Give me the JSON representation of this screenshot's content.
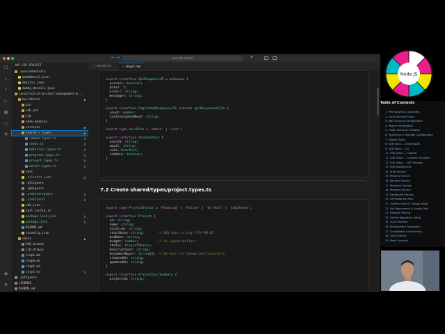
{
  "window": {
    "search_text": "aws-cdk-project",
    "traffic_colors": [
      "#ff5f57",
      "#febc2e",
      "#28c840"
    ]
  },
  "explorer": {
    "header": "AWS-CDK-PROJECT",
    "rows": [
      {
        "label": ".awscredentials",
        "indent": 0,
        "kind": "folder",
        "badge": ""
      },
      {
        "label": "demoDetail.json",
        "indent": 1,
        "kind": "json",
        "badge": ""
      },
      {
        "label": "details.json",
        "indent": 1,
        "kind": "json",
        "badge": ""
      },
      {
        "label": "dummy_details.json",
        "indent": 1,
        "kind": "json",
        "badge": ""
      },
      {
        "label": "construction-project-management-b...",
        "indent": 0,
        "kind": "folder",
        "badge": ""
      },
      {
        "label": "buildtrack",
        "indent": 1,
        "kind": "folder",
        "badge": "●"
      },
      {
        "label": "bin",
        "indent": 2,
        "kind": "folder",
        "badge": ""
      },
      {
        "label": "cdk.out",
        "indent": 2,
        "kind": "folder",
        "badge": ""
      },
      {
        "label": "lib",
        "indent": 2,
        "kind": "folder",
        "badge": ""
      },
      {
        "label": "node_modules",
        "indent": 2,
        "kind": "folder",
        "badge": ""
      },
      {
        "label": "services",
        "indent": 2,
        "kind": "folder",
        "badge": "●"
      },
      {
        "label": "shared / types",
        "indent": 2,
        "kind": "folder",
        "badge": "●"
      },
      {
        "label": "common.types.ts",
        "indent": 3,
        "kind": "ts",
        "badge": "U"
      },
      {
        "label": "index.ts",
        "indent": 3,
        "kind": "ts",
        "badge": "U"
      },
      {
        "label": "materials.types.ts",
        "indent": 3,
        "kind": "ts",
        "badge": "U"
      },
      {
        "label": "progress.types.ts",
        "indent": 3,
        "kind": "ts",
        "badge": "U"
      },
      {
        "label": "project.types.ts",
        "indent": 3,
        "kind": "ts",
        "badge": "U"
      },
      {
        "label": "worker.types.ts",
        "indent": 3,
        "kind": "ts",
        "badge": "U"
      },
      {
        "label": "test",
        "indent": 2,
        "kind": "folder",
        "badge": ""
      },
      {
        "label": ".eslintrc.json",
        "indent": 2,
        "kind": "json",
        "badge": "U"
      },
      {
        "label": ".gitignore",
        "indent": 2,
        "kind": "txt",
        "badge": ""
      },
      {
        "label": ".npmignore",
        "indent": 2,
        "kind": "txt",
        "badge": ""
      },
      {
        "label": ".prettierignore",
        "indent": 2,
        "kind": "txt",
        "badge": "U"
      },
      {
        "label": ".prettierrc",
        "indent": 2,
        "kind": "txt",
        "badge": "U"
      },
      {
        "label": "cdk.json",
        "indent": 2,
        "kind": "json",
        "badge": ""
      },
      {
        "label": "jest.config.js",
        "indent": 2,
        "kind": "js",
        "badge": ""
      },
      {
        "label": "package-lock.json",
        "indent": 2,
        "kind": "json",
        "badge": "U"
      },
      {
        "label": "package.json",
        "indent": 2,
        "kind": "json",
        "badge": "U"
      },
      {
        "label": "README.md",
        "indent": 2,
        "kind": "md",
        "badge": ""
      },
      {
        "label": "tsconfig.json",
        "indent": 2,
        "kind": "json",
        "badge": ""
      },
      {
        "label": "notes",
        "indent": 1,
        "kind": "folder",
        "badge": "●"
      },
      {
        "label": "HLD.drawio",
        "indent": 2,
        "kind": "txt",
        "badge": ""
      },
      {
        "label": "LLD.drawio",
        "indent": 2,
        "kind": "txt",
        "badge": ""
      },
      {
        "label": "step1.md",
        "indent": 2,
        "kind": "md",
        "badge": ""
      },
      {
        "label": "step4.md",
        "indent": 2,
        "kind": "md",
        "badge": ""
      },
      {
        "label": "step5.md",
        "indent": 2,
        "kind": "md",
        "badge": ""
      },
      {
        "label": "step6.md",
        "indent": 2,
        "kind": "md",
        "badge": "U"
      },
      {
        "label": ".gitignore",
        "indent": 0,
        "kind": "txt",
        "badge": ""
      },
      {
        "label": "LICENSE",
        "indent": 0,
        "kind": "txt",
        "badge": ""
      },
      {
        "label": "README.md",
        "indent": 0,
        "kind": "md",
        "badge": ""
      }
    ]
  },
  "tabs": [
    {
      "label": "step6.md",
      "active": false
    },
    {
      "label": "step7.md",
      "active": true
    }
  ],
  "editor": {
    "section_heading": "7.2 Create shared/types/project.types.ts",
    "block1": [
      [
        [
          "kw",
          "export interface "
        ],
        [
          "ty",
          "ApiResponse"
        ],
        [
          "",
          "<T = "
        ],
        [
          "ty",
          "unknown"
        ],
        [
          "",
          "> {"
        ]
      ],
      [
        [
          "",
          "  success: "
        ],
        [
          "ty",
          "boolean"
        ],
        [
          "",
          ";"
        ]
      ],
      [
        [
          "",
          "  data?: T;"
        ]
      ],
      [
        [
          "",
          "  error?: "
        ],
        [
          "ty",
          "string"
        ],
        [
          "",
          ";"
        ]
      ],
      [
        [
          "",
          "  message?: "
        ],
        [
          "ty",
          "string"
        ],
        [
          "",
          ";"
        ]
      ],
      [
        [
          "",
          "}"
        ]
      ],
      [
        [
          "",
          ""
        ]
      ],
      [
        [
          "kw",
          "export interface "
        ],
        [
          "ty",
          "PaginatedResponse"
        ],
        [
          "",
          "<T> "
        ],
        [
          "kw",
          "extends "
        ],
        [
          "ty",
          "ApiResponse"
        ],
        [
          "",
          "<T[]> {"
        ]
      ],
      [
        [
          "",
          "  count: "
        ],
        [
          "ty",
          "number"
        ],
        [
          "",
          ";"
        ]
      ],
      [
        [
          "",
          "  lastEvaluatedKey?: "
        ],
        [
          "ty",
          "string"
        ],
        [
          "",
          ";"
        ]
      ],
      [
        [
          "",
          "}"
        ]
      ],
      [
        [
          "",
          ""
        ]
      ],
      [
        [
          "kw",
          "export type "
        ],
        [
          "ty",
          "UserRole"
        ],
        [
          "",
          " = "
        ],
        [
          "st",
          "'admin'"
        ],
        [
          "",
          " | "
        ],
        [
          "st",
          "'user'"
        ],
        [
          "",
          ";"
        ]
      ],
      [
        [
          "",
          ""
        ]
      ],
      [
        [
          "kw",
          "export interface "
        ],
        [
          "ty",
          "AuthContext"
        ],
        [
          "",
          " {"
        ]
      ],
      [
        [
          "",
          "  userId: "
        ],
        [
          "ty",
          "string"
        ],
        [
          "",
          ";"
        ]
      ],
      [
        [
          "",
          "  email: "
        ],
        [
          "ty",
          "string"
        ],
        [
          "",
          ";"
        ]
      ],
      [
        [
          "",
          "  role: "
        ],
        [
          "ty",
          "UserRole"
        ],
        [
          "",
          ";"
        ]
      ],
      [
        [
          "",
          "  isAdmin: "
        ],
        [
          "ty",
          "boolean"
        ],
        [
          "",
          ";"
        ]
      ],
      [
        [
          "",
          "}"
        ]
      ]
    ],
    "block2": [
      [
        [
          "kw",
          "export type "
        ],
        [
          "ty",
          "ProjectStatus"
        ],
        [
          "",
          " = "
        ],
        [
          "st",
          "'Planning'"
        ],
        [
          "",
          " | "
        ],
        [
          "st",
          "'Active'"
        ],
        [
          "",
          " | "
        ],
        [
          "st",
          "'On Hold'"
        ],
        [
          "",
          " | "
        ],
        [
          "st",
          "'Completed'"
        ],
        [
          "",
          ";"
        ]
      ],
      [
        [
          "",
          ""
        ]
      ],
      [
        [
          "kw",
          "export interface "
        ],
        [
          "ty",
          "Project"
        ],
        [
          "",
          " {"
        ]
      ],
      [
        [
          "",
          "  id: "
        ],
        [
          "ty",
          "string"
        ],
        [
          "",
          ";"
        ]
      ],
      [
        [
          "",
          "  name: "
        ],
        [
          "ty",
          "string"
        ],
        [
          "",
          ";"
        ]
      ],
      [
        [
          "",
          "  location: "
        ],
        [
          "ty",
          "string"
        ],
        [
          "",
          ";"
        ]
      ],
      [
        [
          "",
          "  startDate: "
        ],
        [
          "ty",
          "string"
        ],
        [
          "",
          ";       "
        ],
        [
          "cm",
          "// ISO date string YYYY-MM-DD"
        ]
      ],
      [
        [
          "",
          "  endDate: "
        ],
        [
          "ty",
          "string"
        ],
        [
          "",
          ";"
        ]
      ],
      [
        [
          "",
          "  budget: "
        ],
        [
          "ty",
          "number"
        ],
        [
          "",
          ";          "
        ],
        [
          "cm",
          "// in rupees/dollars"
        ]
      ],
      [
        [
          "",
          "  status: "
        ],
        [
          "ty",
          "ProjectStatus"
        ],
        [
          "",
          ";"
        ]
      ],
      [
        [
          "",
          "  description?: "
        ],
        [
          "ty",
          "string"
        ],
        [
          "",
          ";"
        ]
      ],
      [
        [
          "",
          "  documentKeys?: "
        ],
        [
          "ty",
          "string"
        ],
        [
          "",
          "[]; "
        ],
        [
          "cm",
          "// S3 keys for blueprints/contracts"
        ]
      ],
      [
        [
          "",
          "  createdAt: "
        ],
        [
          "ty",
          "string"
        ],
        [
          "",
          ";"
        ]
      ],
      [
        [
          "",
          "  updatedAt: "
        ],
        [
          "ty",
          "string"
        ],
        [
          "",
          ";"
        ]
      ],
      [
        [
          "",
          "}"
        ]
      ],
      [
        [
          "",
          ""
        ]
      ],
      [
        [
          "kw",
          "export interface "
        ],
        [
          "ty",
          "ProjectCostSummary"
        ],
        [
          "",
          " {"
        ]
      ],
      [
        [
          "",
          "  projectId: "
        ],
        [
          "ty",
          "string"
        ],
        [
          "",
          ";"
        ]
      ]
    ]
  },
  "toc": {
    "title": "Table of Contents",
    "items": [
      "1. Prerequisites & Accounts",
      "2. Local Machine Setup",
      "3. AWS Account Configuration",
      "4. Project Initialization",
      "5. Folder Structure Creation",
      "6. TypeScript & Package Configuration",
      "7. Shared Types",
      "8. CDK Stack — DynamoDB",
      "9. CDK Stack — S3",
      "10. CDK Stack — Cognito",
      "11. CDK Stack — Lambda Functions",
      "12. CDK Stack — API Gateway",
      "13. First Deployment",
      "14. Auth Service",
      "15. Projects Service",
      "16. Workers Service",
      "17. Materials Service",
      "18. Progress Service",
      "19. Dashboard Service",
      "20. S3 Presigned URLs",
      "21. Cognito Users & Groups Setup",
      "22. Full Deployment & Smoke Test",
      "23. Postman Testing",
      "24. GitHub Repository Setup",
      "25. CI/CD Pipeline",
      "26. Environment Separation",
      "27. CloudWatch & Monitoring",
      "28. Cost Controls",
      "29. Final Checklist"
    ]
  },
  "wheel": {
    "label": "Node.JS",
    "colors": [
      "#ffffff",
      "#e91e8c",
      "#f2e600",
      "#00b8c4",
      "#111111"
    ]
  }
}
